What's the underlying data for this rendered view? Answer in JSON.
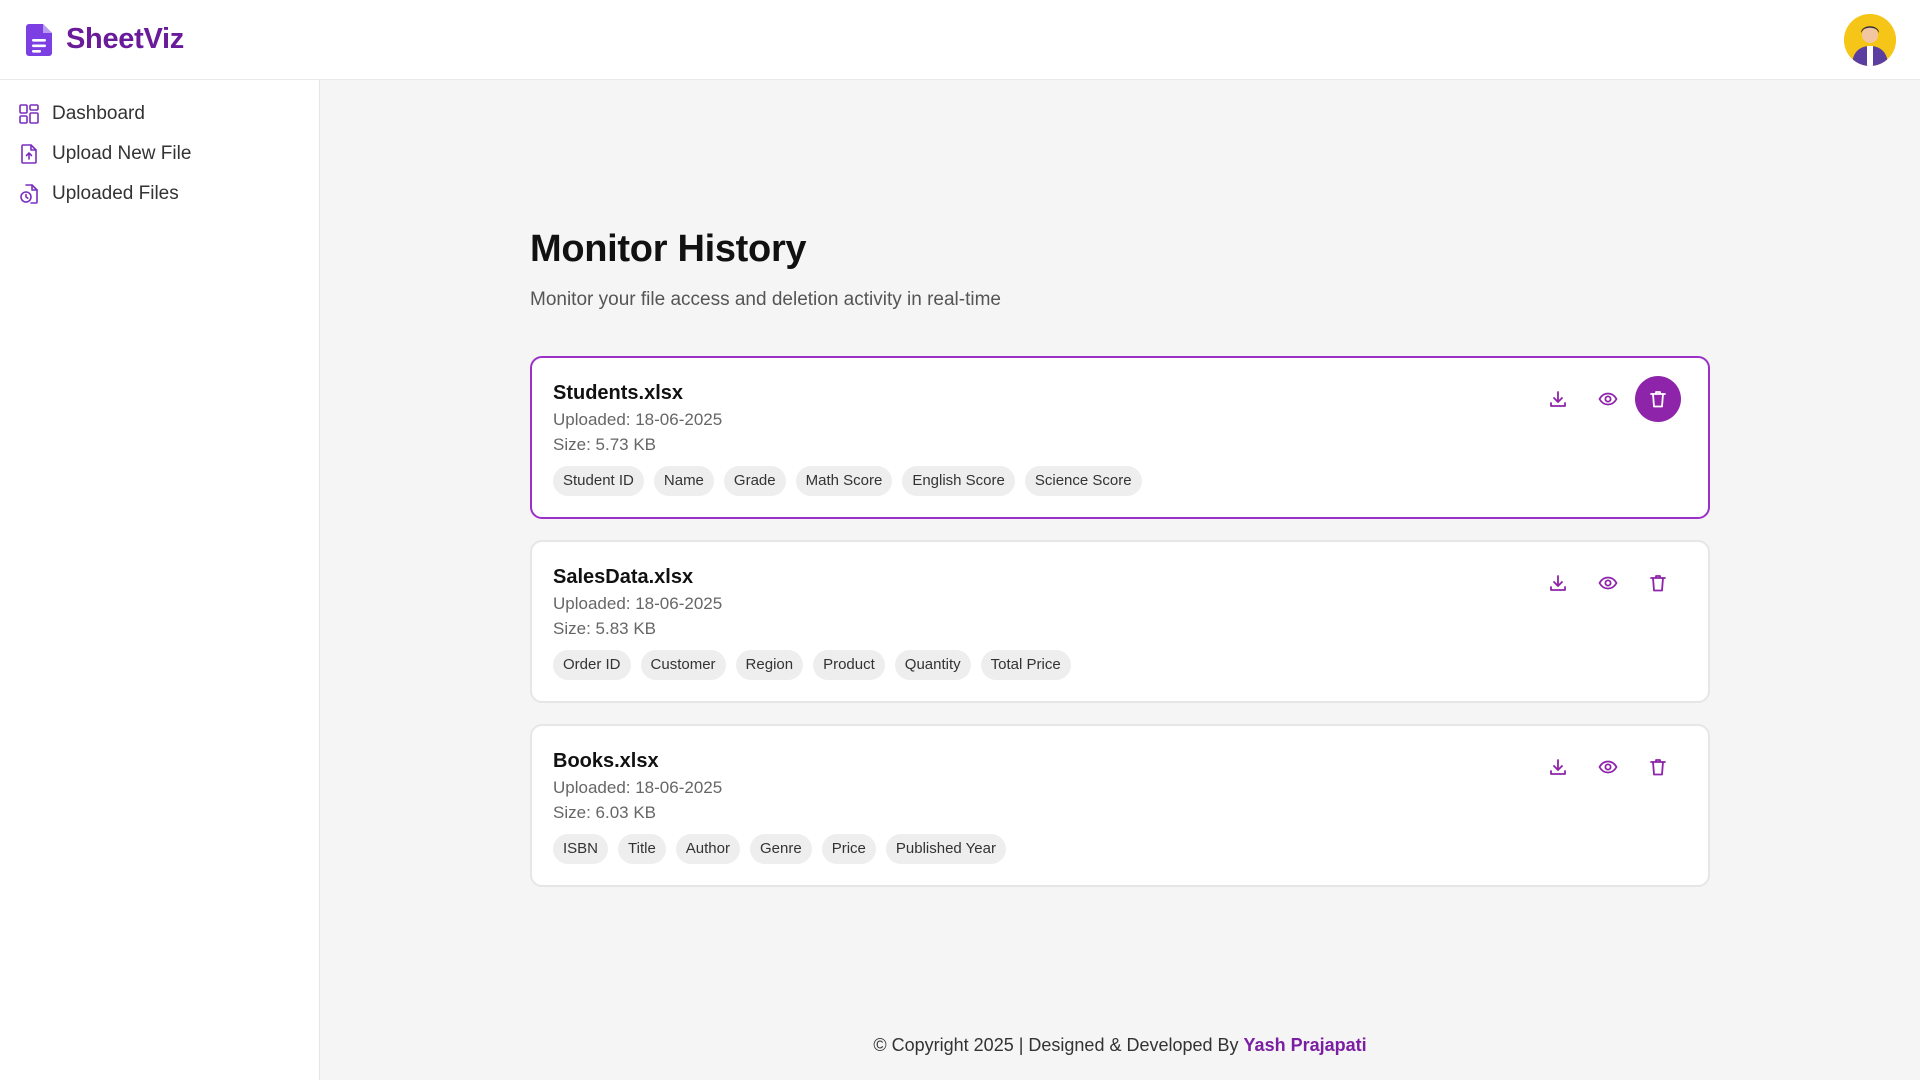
{
  "brand": {
    "name": "SheetViz",
    "color": "#9b30c8",
    "icon": "file-document-icon"
  },
  "colors": {
    "accent": "#8e24aa",
    "text": "#111111",
    "muted": "#666666",
    "tag_bg": "#eeeeee"
  },
  "sidebar": {
    "items": [
      {
        "label": "Dashboard",
        "icon": "dashboard-grid-icon"
      },
      {
        "label": "Upload New File",
        "icon": "file-upload-icon"
      },
      {
        "label": "Uploaded Files",
        "icon": "file-history-icon"
      }
    ]
  },
  "main": {
    "title": "Monitor History",
    "subtitle": "Monitor your file access and deletion activity in real-time"
  },
  "files": [
    {
      "name": "Students.xlsx",
      "uploaded": "Uploaded: 18-06-2025",
      "size": "Size: 5.73 KB",
      "columns": [
        "Student ID",
        "Name",
        "Grade",
        "Math Score",
        "English Score",
        "Science Score"
      ],
      "active": true
    },
    {
      "name": "SalesData.xlsx",
      "uploaded": "Uploaded: 18-06-2025",
      "size": "Size: 5.83 KB",
      "columns": [
        "Order ID",
        "Customer",
        "Region",
        "Product",
        "Quantity",
        "Total Price"
      ],
      "active": false
    },
    {
      "name": "Books.xlsx",
      "uploaded": "Uploaded: 18-06-2025",
      "size": "Size: 6.03 KB",
      "columns": [
        "ISBN",
        "Title",
        "Author",
        "Genre",
        "Price",
        "Published Year"
      ],
      "active": false
    }
  ],
  "actions": {
    "download_icon": "download-icon",
    "view_icon": "eye-icon",
    "delete_icon": "trash-icon"
  },
  "footer": {
    "text": "© Copyright 2025 | Designed & Developed By",
    "author": "Yash Prajapati"
  }
}
